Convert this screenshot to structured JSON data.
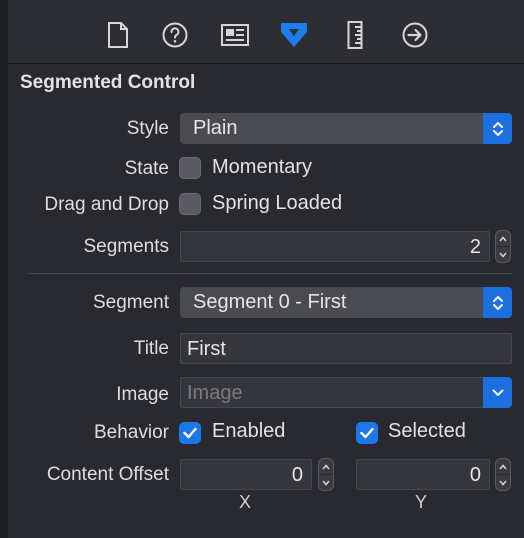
{
  "tabs": [
    {
      "name": "file-inspector",
      "icon": "document-icon"
    },
    {
      "name": "quick-help",
      "icon": "question-mark-icon"
    },
    {
      "name": "identity-inspector",
      "icon": "identity-card-icon"
    },
    {
      "name": "attributes-inspector",
      "icon": "attributes-icon",
      "selected": true
    },
    {
      "name": "size-inspector",
      "icon": "ruler-icon"
    },
    {
      "name": "connections-inspector",
      "icon": "arrow-circle-icon"
    }
  ],
  "section": {
    "title": "Segmented Control"
  },
  "fields": {
    "style": {
      "label": "Style",
      "value": "Plain"
    },
    "state": {
      "label": "State",
      "checkbox_label": "Momentary",
      "checked": false
    },
    "drag_drop": {
      "label": "Drag and Drop",
      "checkbox_label": "Spring Loaded",
      "checked": false
    },
    "segments": {
      "label": "Segments",
      "value": "2"
    },
    "segment": {
      "label": "Segment",
      "value": "Segment 0 - First"
    },
    "title": {
      "label": "Title",
      "value": "First"
    },
    "image": {
      "label": "Image",
      "placeholder": "Image"
    },
    "behavior": {
      "label": "Behavior",
      "enabled_label": "Enabled",
      "enabled": true,
      "selected_label": "Selected",
      "selected": true
    },
    "content_offset": {
      "label": "Content Offset",
      "x_value": "0",
      "y_value": "0",
      "x_caption": "X",
      "y_caption": "Y"
    }
  },
  "colors": {
    "accent": "#1b6fdf",
    "active_tab": "#1c7cf0",
    "background": "#292a2f"
  }
}
